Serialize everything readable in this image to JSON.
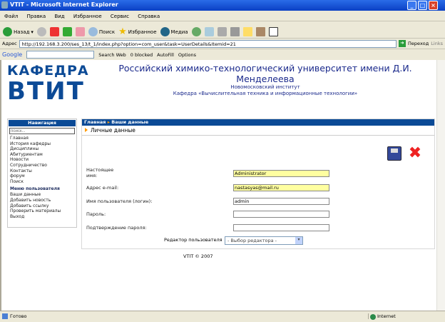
{
  "window": {
    "title": "VTIT - Microsoft Internet Explorer"
  },
  "menu": [
    "Файл",
    "Правка",
    "Вид",
    "Избранное",
    "Сервис",
    "Справка"
  ],
  "toolbar": {
    "back": "Назад",
    "search": "Поиск",
    "favorites": "Избранное",
    "media": "Медиа"
  },
  "address": {
    "label": "Адрес",
    "url": "http://192.168.3.200/ses_13/t_1/index.php?option=com_user&task=UserDetails&Itemid=21",
    "go": "Переход",
    "links": "Links"
  },
  "google": {
    "logo": "Google",
    "search_web": "Search Web",
    "blocked": "0 blocked",
    "autofill": "AutoFill",
    "options": "Options"
  },
  "header": {
    "logo_top": "КАФЕДРА",
    "logo_bottom": "ВТИТ",
    "line1": "Российский химико-технологический университет имени Д.И. Менделеева",
    "line2": "Новомосковский институт",
    "line3": "Кафедра «Вычислительная техника и информационные технологии»"
  },
  "sidebar": {
    "title": "Навигация",
    "search_placeholder": "поиск...",
    "items": [
      "Главная",
      "История кафедры",
      "Дисциплины",
      "Абитуриентам",
      "Новости",
      "Сотрудничество",
      "Контакты",
      "форум",
      "Поиск"
    ],
    "user_menu_title": "Меню пользователя",
    "user_items": [
      "Ваши данные",
      "Добавить новость",
      "Добавить ссылку",
      "Проверить материалы",
      "Выход"
    ]
  },
  "main": {
    "breadcrumb_home": "Главная",
    "breadcrumb_current": "Ваши данные",
    "title": "Личные данные",
    "fields": [
      {
        "label": "Настоящее имя:",
        "value": "Administrator"
      },
      {
        "label": "Адрес e-mail:",
        "value": "nastasyas@mail.ru"
      },
      {
        "label": "Имя пользователя (логин):",
        "value": "admin"
      },
      {
        "label": "Пароль:",
        "value": ""
      },
      {
        "label": "Подтверждение пароля:",
        "value": ""
      }
    ],
    "editor_label": "Редактор пользователя",
    "editor_value": "- Выбор редактора -"
  },
  "footer": "VTIT © 2007",
  "status": {
    "text": "Готово",
    "zone": "Internet"
  }
}
